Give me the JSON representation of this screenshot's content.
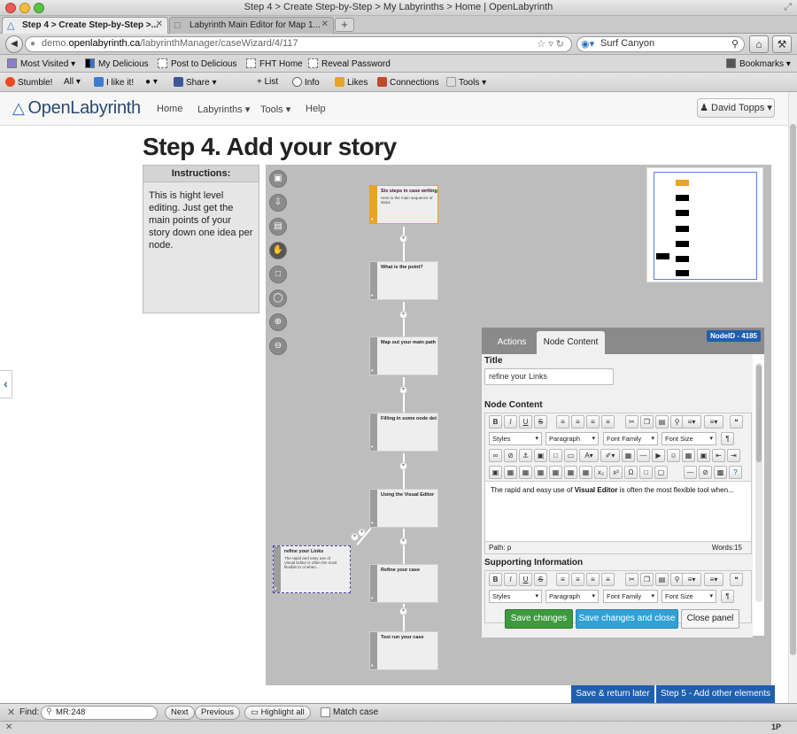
{
  "window": {
    "title": "Step 4 > Create Step-by-Step > My Labyrinths > Home | OpenLabyrinth"
  },
  "tabs": [
    {
      "label": "Step 4 > Create Step-by-Step >...",
      "active": true
    },
    {
      "label": "Labyrinth Main Editor for Map 1...",
      "active": false
    }
  ],
  "address": {
    "scheme_host_prefix": "demo.",
    "host": "openlabyrinth.ca",
    "path": "/labyrinthManager/caseWizard/4/117"
  },
  "search": {
    "value": "Surf Canyon"
  },
  "bookmarks": [
    "Most Visited",
    "My Delicious",
    "Post to Delicious",
    "FHT Home",
    "Reveal Password",
    "Bookmarks"
  ],
  "stumble": {
    "items": [
      "Stumble!",
      "All",
      "I like it!",
      "Share",
      "List",
      "Info",
      "Likes",
      "Connections",
      "Tools"
    ]
  },
  "app": {
    "logo": "OpenLabyrinth",
    "nav": [
      "Home",
      "Labyrinths",
      "Tools",
      "Help"
    ],
    "user": "David Topps"
  },
  "step": {
    "title": "Step 4. Add your story"
  },
  "instructions": {
    "heading": "Instructions:",
    "body": "This is hight level editing. Just get the main points of your story down one idea per node."
  },
  "nodes": [
    {
      "title": "Six steps in case writing",
      "sub": "Here is the main sequence of steps",
      "root": true
    },
    {
      "title": "What is the point?"
    },
    {
      "title": "Map out your main path"
    },
    {
      "title": "Filling in some node det"
    },
    {
      "title": "Using the Visual Editor"
    },
    {
      "title": "Refine your case"
    },
    {
      "title": "Test run your case"
    },
    {
      "title": "refine your Links",
      "sub": "The rapid and easy use of Visual Editor is often the most flexible to ol when...",
      "selected": true
    }
  ],
  "panel": {
    "tabs": [
      "Actions",
      "Node Content"
    ],
    "node_id": "NodeID - 4185",
    "title_label": "Title",
    "title_value": "refine your Links",
    "content_label": "Node Content",
    "styles": "Styles",
    "paragraph": "Paragraph",
    "font_family": "Font Family",
    "font_size": "Font Size",
    "content_text_pre": "The rapid and easy use of ",
    "content_text_bold": "Visual Editor",
    "content_text_post": " is often the most flexible tool when...",
    "path": "Path: p",
    "words": "Words:15",
    "supporting_label": "Supporting Information",
    "save": "Save changes",
    "save_close": "Save changes and close",
    "close": "Close panel"
  },
  "bottom": {
    "return_later": "Save & return later",
    "next_step": "Step 5 - Add other elements"
  },
  "find": {
    "label": "Find:",
    "value": "MR:248",
    "next": "Next",
    "previous": "Previous",
    "highlight": "Highlight all",
    "match_case": "Match case"
  },
  "status": {
    "right": "1P"
  },
  "colors": {
    "accent": "#1f5fae",
    "root_node": "#e8a523",
    "save": "#3e9a3e",
    "save_close": "#31a1d6"
  }
}
